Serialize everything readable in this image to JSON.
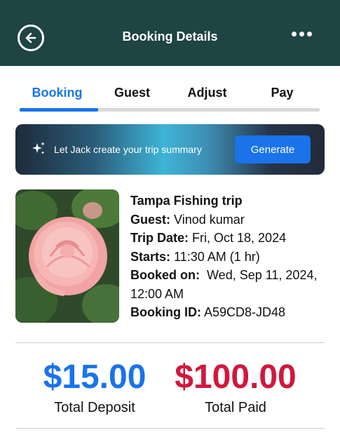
{
  "header": {
    "title": "Booking Details",
    "back_icon": "back-arrow-icon",
    "more_icon": "more-dots-icon",
    "background": "#1f4444"
  },
  "tabs": [
    {
      "label": "Booking",
      "active": true
    },
    {
      "label": "Guest",
      "active": false
    },
    {
      "label": "Adjust",
      "active": false
    },
    {
      "label": "Pay",
      "active": false
    }
  ],
  "ai_banner": {
    "icon": "sparkle-icon",
    "text": "Let Jack create your trip summary",
    "button_label": "Generate"
  },
  "booking": {
    "photo": "pink-rose-image",
    "title": "Tampa Fishing trip",
    "guest_label": "Guest:",
    "guest_value": "Vinod kumar",
    "trip_date_label": "Trip Date:",
    "trip_date_value": "Fri, Oct 18, 2024",
    "starts_label": "Starts:",
    "starts_value": "11:30 AM (1 hr)",
    "booked_on_label": "Booked on:",
    "booked_on_value": "Wed, Sep 11, 2024,",
    "booked_on_value_2": "12:00 AM",
    "booking_id_label": "Booking ID:",
    "booking_id_value": "A59CD8-JD48"
  },
  "totals": {
    "deposit_amount": "$15.00",
    "deposit_label": "Total Deposit",
    "deposit_color": "#1a73e8",
    "paid_amount": "$100.00",
    "paid_label": "Total Paid",
    "paid_color": "#d0183e"
  }
}
